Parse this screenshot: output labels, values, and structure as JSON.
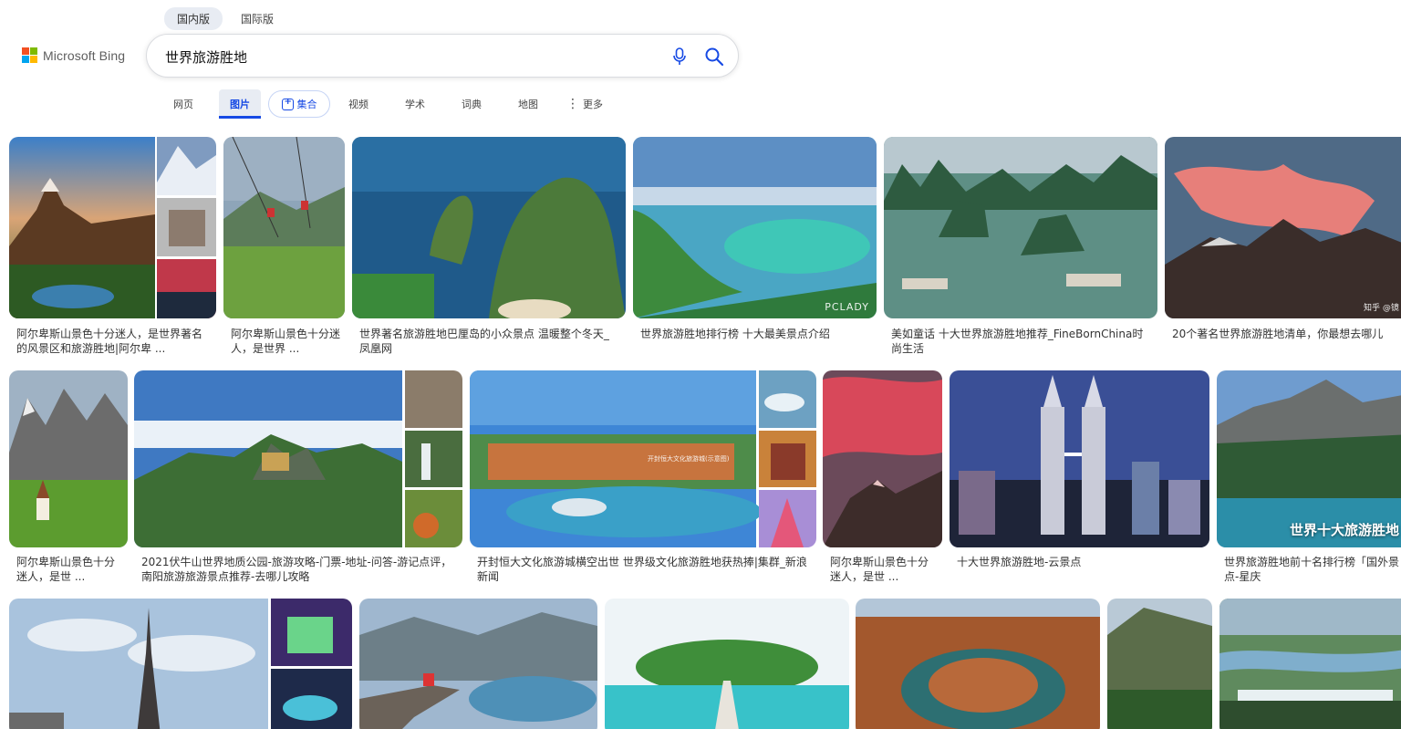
{
  "brand": {
    "name": "Microsoft Bing",
    "colors": [
      "#f25022",
      "#7fba00",
      "#00a4ef",
      "#ffb900"
    ]
  },
  "region_tabs": [
    {
      "label": "国内版",
      "active": true
    },
    {
      "label": "国际版",
      "active": false
    }
  ],
  "search": {
    "query": "世界旅游胜地",
    "mic_icon": "microphone-icon",
    "search_icon": "search-icon"
  },
  "nav": [
    {
      "label": "网页"
    },
    {
      "label": "图片",
      "active": true
    },
    {
      "label": "集合",
      "icon": "collections-icon"
    },
    {
      "label": "视频"
    },
    {
      "label": "学术"
    },
    {
      "label": "词典"
    },
    {
      "label": "地图"
    },
    {
      "label": "更多",
      "icon": "more-icon"
    }
  ],
  "accent_color": "#174ae4",
  "results": [
    {
      "caption": "阿尔卑斯山景色十分迷人，是世界著名的风景区和旅游胜地|阿尔卑 ..."
    },
    {
      "caption": "阿尔卑斯山景色十分迷人，是世界 ..."
    },
    {
      "caption": "世界著名旅游胜地巴厘岛的小众景点 温暖整个冬天_凤凰网"
    },
    {
      "caption": "世界旅游胜地排行榜 十大最美景点介绍",
      "watermark": "PCLADY"
    },
    {
      "caption": "美如童话 十大世界旅游胜地推荐_FineBornChina时尚生活"
    },
    {
      "caption": "20个著名世界旅游胜地清单，你最想去哪儿",
      "watermark": "知乎 @镜"
    },
    {
      "caption": "阿尔卑斯山景色十分迷人，是世 ..."
    },
    {
      "caption": "2021伏牛山世界地质公园-旅游攻略-门票-地址-问答-游记点评，南阳旅游旅游景点推荐-去哪儿攻略"
    },
    {
      "caption": "开封恒大文化旅游城横空出世 世界级文化旅游胜地获热捧|集群_新浪新闻",
      "banner": "开封恒大文化旅游城(示意图)"
    },
    {
      "caption": "阿尔卑斯山景色十分迷人，是世 ..."
    },
    {
      "caption": "十大世界旅游胜地-云景点"
    },
    {
      "caption": "世界旅游胜地前十名排行榜「国外景点-星庆",
      "overlay": "世界十大旅游胜地"
    },
    {
      "caption": ""
    },
    {
      "caption": ""
    },
    {
      "caption": ""
    },
    {
      "caption": ""
    },
    {
      "caption": ""
    },
    {
      "caption": ""
    }
  ]
}
